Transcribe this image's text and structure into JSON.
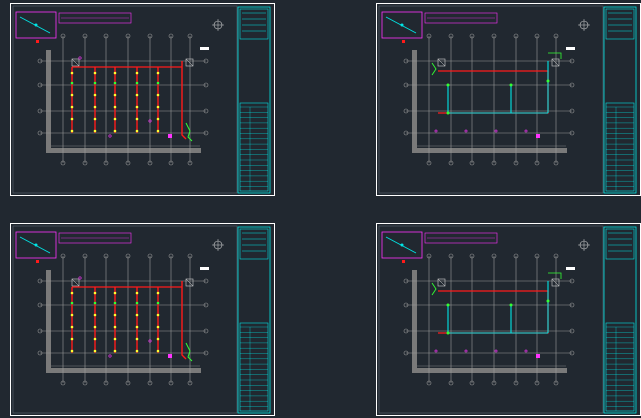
{
  "colors": {
    "background": "#212830",
    "frame": "#ffffff",
    "title_block": "#00e5e5",
    "grid": "#9a9a9a",
    "wall": "#7a7a7a",
    "pipe_red": "#ff1a1a",
    "pipe_cyan": "#00e5e5",
    "node_yellow": "#ffff33",
    "node_green": "#33ff33",
    "magenta": "#ff33ff"
  },
  "sheets": [
    {
      "id": "sheet-top-left",
      "variant": "sprinkler"
    },
    {
      "id": "sheet-top-right",
      "variant": "main"
    },
    {
      "id": "sheet-bottom-left",
      "variant": "sprinkler"
    },
    {
      "id": "sheet-bottom-right",
      "variant": "main"
    }
  ]
}
